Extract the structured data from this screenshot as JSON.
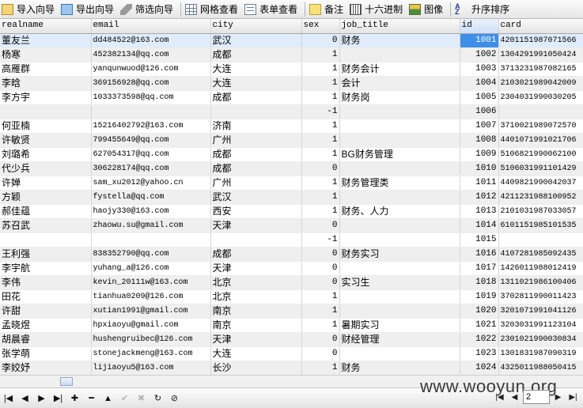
{
  "toolbar": {
    "import_wizard": "导入向导",
    "export_wizard": "导出向导",
    "filter_wizard": "筛选向导",
    "grid_view": "网格查看",
    "form_view": "表单查看",
    "memo": "备注",
    "hex": "十六进制",
    "image": "图像",
    "sort_asc": "升序排序"
  },
  "columns": [
    "realname",
    "email",
    "city",
    "sex",
    "job_title",
    "id",
    "card"
  ],
  "rows": [
    [
      "董友兰",
      "dd484522@163.com",
      "武汉",
      "0",
      "财务",
      "1001",
      "4201151987071566"
    ],
    [
      "杨寒",
      "452382134@qq.com",
      "成都",
      "1",
      "",
      "1002",
      "1304291991050424"
    ],
    [
      "高雁群",
      "yanqunwuod@126.com",
      "大连",
      "1",
      "财务会计",
      "1003",
      "3713231987082165"
    ],
    [
      "李晗",
      "369156928@qq.com",
      "大连",
      "1",
      "会计",
      "1004",
      "2103021989042009"
    ],
    [
      "李方宇",
      "1033373598@qq.com",
      "成都",
      "1",
      "财务岗",
      "1005",
      "2304031990030205"
    ],
    [
      "",
      "",
      "",
      "-1",
      "",
      "1006",
      ""
    ],
    [
      "何亚楠",
      "15216402792@163.com",
      "济南",
      "1",
      "",
      "1007",
      "3710021989072570"
    ],
    [
      "许敏贤",
      "799455649@qq.com",
      "广州",
      "1",
      "",
      "1008",
      "4401071991021706"
    ],
    [
      "刘璐希",
      "627054317@qq.com",
      "成都",
      "1",
      "BG财务管理",
      "1009",
      "5106821990062100"
    ],
    [
      "代少兵",
      "306228174@qq.com",
      "成都",
      "0",
      "",
      "1010",
      "5106031991101429"
    ],
    [
      "许婵",
      "sam_xu2012@yahoo.cn",
      "广州",
      "1",
      "财务管理类",
      "1011",
      "4409821990042037"
    ],
    [
      "方颖",
      "fystella@qq.com",
      "武汉",
      "1",
      "",
      "1012",
      "4211231988100952"
    ],
    [
      "郝佳蕴",
      "haojy330@163.com",
      "西安",
      "1",
      "财务、人力",
      "1013",
      "2101031987033057"
    ],
    [
      "苏召武",
      "zhaowu.su@gmail.com",
      "天津",
      "0",
      "",
      "1014",
      "6101151985101535"
    ],
    [
      "",
      "",
      "",
      "-1",
      "",
      "1015",
      ""
    ],
    [
      "王利强",
      "838352790@qq.com",
      "成都",
      "0",
      "财务实习",
      "1016",
      "4107281985092435"
    ],
    [
      "李宇航",
      "yuhang_a@126.com",
      "天津",
      "0",
      "",
      "1017",
      "1426011988012419"
    ],
    [
      "李伟",
      "kevin_20111w@163.com",
      "北京",
      "0",
      "实习生",
      "1018",
      "1311021986100406"
    ],
    [
      "田花",
      "tianhua0209@126.com",
      "北京",
      "1",
      "",
      "1019",
      "3702811990011423"
    ],
    [
      "许甜",
      "xutian1991@gmail.com",
      "南京",
      "1",
      "",
      "1020",
      "3201071991041126"
    ],
    [
      "孟晓煜",
      "hpxiaoyu@gmail.com",
      "南京",
      "1",
      "暑期实习",
      "1021",
      "3203031991123104"
    ],
    [
      "胡晨睿",
      "hushengruibec@126.com",
      "天津",
      "0",
      "财经管理",
      "1022",
      "2301021990030834"
    ],
    [
      "张学萌",
      "stonejackmeng@163.com",
      "大连",
      "0",
      "",
      "1023",
      "1301831987090319"
    ],
    [
      "李姣妤",
      "lijiaoyu5@163.com",
      "长沙",
      "1",
      "财务",
      "1024",
      "4325011988050415"
    ]
  ],
  "pager": {
    "page": "2"
  },
  "watermark": "www.wooyun.org"
}
